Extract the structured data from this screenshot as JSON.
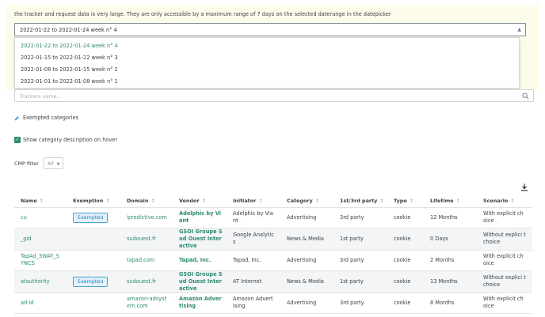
{
  "notice": "the tracker and request data is very large. They are only accessible by a maximum range of 7 days on the selected daterange in the datepicker",
  "date_select": {
    "value": "2022-01-22 to 2022-01-24 week n° 4",
    "options": [
      "2022-01-22 to 2022-01-24 week n° 4",
      "2022-01-15 to 2022-01-22 week n° 3",
      "2022-01-08 to 2022-01-15 week n° 2",
      "2022-01-01 to 2022-01-08 week n° 1"
    ],
    "selected_index": 0
  },
  "search": {
    "placeholder": "Trackers name..."
  },
  "exempted_link": "Exempted categories",
  "show_description": {
    "label": "Show category description on hover",
    "checked": true
  },
  "cmp_filter": {
    "label": "CMP filter",
    "value": "All"
  },
  "table": {
    "headers": [
      "Name",
      "Exemption",
      "Domain",
      "Vendor",
      "Initiator",
      "Category",
      "1st/3rd party",
      "Type",
      "Lifetime",
      "Scenario"
    ],
    "sort_icon": "↕",
    "rows": [
      {
        "name": "cu",
        "exemption": "Exempted",
        "domain": "ipredictive.com",
        "vendor": "Adelphic by Vi ant",
        "initiator": "Adelphic by Via nt",
        "category": "Advertising",
        "party": "3rd party",
        "type": "cookie",
        "lifetime": "12 Months",
        "scenario": "With explicit ch oice"
      },
      {
        "name": "_gid",
        "exemption": "",
        "domain": "sudouest.fr",
        "vendor": "GSOI Groupe S ud Ouest Inter active",
        "initiator": "Google Analytic s",
        "category": "News & Media",
        "party": "1st party",
        "type": "cookie",
        "lifetime": "0 Days",
        "scenario": "Without explici t choice"
      },
      {
        "name": "TapAd_3WAY_S YNCS",
        "exemption": "",
        "domain": "tapad.com",
        "vendor": "Tapad, Inc.",
        "initiator": "Tapad, Inc.",
        "category": "Advertising",
        "party": "3rd party",
        "type": "cookie",
        "lifetime": "2 Months",
        "scenario": "With explicit ch oice"
      },
      {
        "name": "atauthority",
        "exemption": "Exempted",
        "domain": "sudouest.fr",
        "vendor": "GSOI Groupe S ud Ouest Inter active",
        "initiator": "AT Internet",
        "category": "News & Media",
        "party": "1st party",
        "type": "cookie",
        "lifetime": "13 Months",
        "scenario": "Without explici t choice"
      },
      {
        "name": "ad-id",
        "exemption": "",
        "domain": "amazon-adsyst em.com",
        "vendor": "Amazon Adver tising",
        "initiator": "Amazon Advert ising",
        "category": "Advertising",
        "party": "3rd party",
        "type": "cookie",
        "lifetime": "8 Months",
        "scenario": "With explicit ch oice"
      }
    ]
  },
  "colors": {
    "accent": "#2e8b6f",
    "badge": "#4aa0d8",
    "banner": "#fdfbea"
  }
}
